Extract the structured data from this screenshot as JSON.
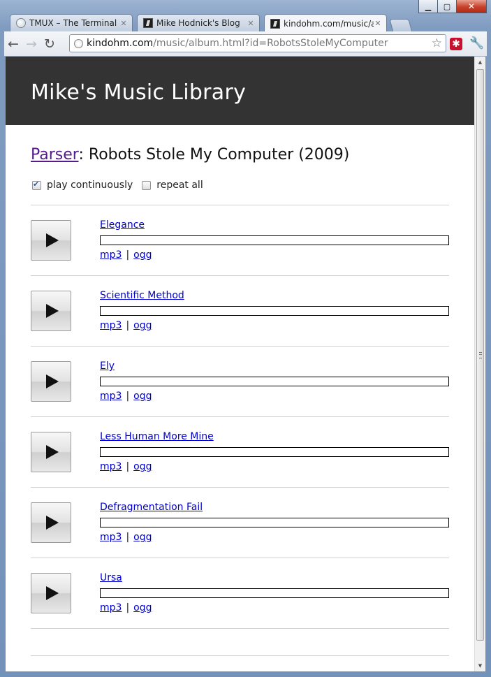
{
  "window": {
    "minimize_label": "▁",
    "maximize_label": "▢",
    "close_label": "✕"
  },
  "tabs": [
    {
      "label": "TMUX – The Terminal Multiplexer",
      "icon": "globe-icon"
    },
    {
      "label": "Mike Hodnick's Blog",
      "icon": "blog-favicon"
    },
    {
      "label": "kindohm.com/music/album.html?id=RobotsStoleMyComputer",
      "icon": "blog-favicon"
    }
  ],
  "toolbar": {
    "back_icon": "arrow-left-icon",
    "forward_icon": "arrow-right-icon",
    "reload_icon": "reload-icon",
    "url_host": "kindohm.com",
    "url_path": "/music/album.html?id=RobotsStoleMyComputer",
    "bookmark_icon": "star-icon",
    "extension_icon": "extension-icon",
    "menu_icon": "wrench-icon"
  },
  "site": {
    "title": "Mike's Music Library"
  },
  "album": {
    "artist": "Parser",
    "separator": ":",
    "title": "Robots Stole My Computer (2009)"
  },
  "options": {
    "play_continuously": {
      "label": "play continuously",
      "checked": true
    },
    "repeat_all": {
      "label": "repeat all",
      "checked": false
    }
  },
  "tracks": [
    {
      "title": "Elegance",
      "mp3": "mp3",
      "ogg": "ogg",
      "progress": 0
    },
    {
      "title": "Scientific Method",
      "mp3": "mp3",
      "ogg": "ogg",
      "progress": 0
    },
    {
      "title": "Ely",
      "mp3": "mp3",
      "ogg": "ogg",
      "progress": 0
    },
    {
      "title": "Less Human More Mine",
      "mp3": "mp3",
      "ogg": "ogg",
      "progress": 0
    },
    {
      "title": "Defragmentation Fail",
      "mp3": "mp3",
      "ogg": "ogg",
      "progress": 0
    },
    {
      "title": "Ursa",
      "mp3": "mp3",
      "ogg": "ogg",
      "progress": 0
    }
  ],
  "link_separator": "|",
  "colors": {
    "header_bg": "#333333",
    "link": "#0000cc",
    "visited_link": "#551a8b"
  }
}
